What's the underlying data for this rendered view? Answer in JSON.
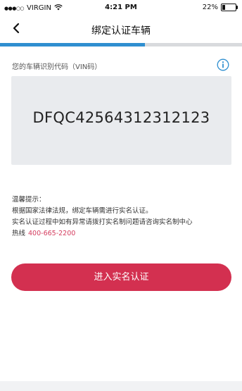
{
  "status_bar": {
    "signal": "●●●○○",
    "carrier": "VIRGIN",
    "wifi_icon": "wifi-icon",
    "time": "4:21 PM",
    "battery_text": "22%",
    "battery_level": 0.22
  },
  "nav": {
    "back_icon": "chevron-left-icon",
    "title": "绑定认证车辆",
    "progress": 0.6
  },
  "vin": {
    "label": "您的车辆识别代码（VIN码）",
    "info_icon": "info-icon",
    "value": "DFQC42564312312123"
  },
  "tips": {
    "heading": "温馨提示：",
    "line1": "根据国家法律法规，绑定车辆需进行实名认证。",
    "line2": "实名认证过程中如有异常请拨打实名制问题请咨询实名制中心",
    "hotline_label": "热线",
    "hotline_number": "400-665-2200"
  },
  "actions": {
    "primary_label": "进入实名认证"
  },
  "colors": {
    "accent": "#d33050",
    "progress": "#2f8fd0",
    "hotline": "#d43c5e"
  }
}
